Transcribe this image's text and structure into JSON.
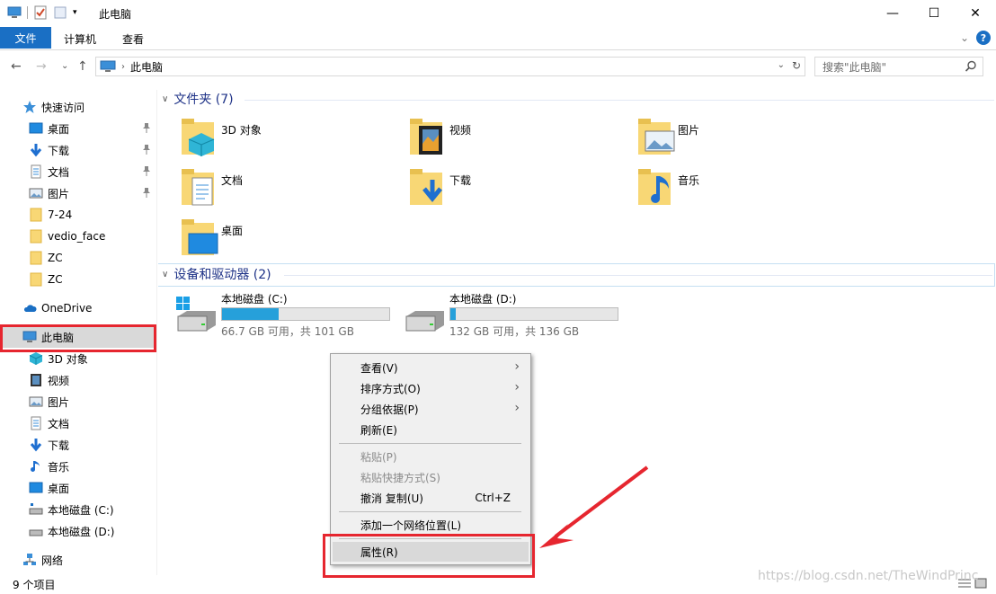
{
  "window": {
    "title": "此电脑",
    "minimize_glyph": "—",
    "maximize_glyph": "☐",
    "close_glyph": "✕"
  },
  "ribbon": {
    "tabs": [
      "文件",
      "计算机",
      "查看"
    ],
    "collapse_glyph": "⌄",
    "help_glyph": "?"
  },
  "nav": {
    "back_glyph": "←",
    "forward_glyph": "→",
    "recent_glyph": "⌄",
    "up_glyph": "↑",
    "breadcrumb": "此电脑",
    "breadcrumb_sep": "›",
    "search_placeholder": "搜索\"此电脑\""
  },
  "sidebar": {
    "items": [
      {
        "label": "快速访问",
        "icon": "star-icon"
      },
      {
        "label": "桌面",
        "icon": "desktop-icon",
        "pinned": true
      },
      {
        "label": "下载",
        "icon": "download-icon",
        "pinned": true
      },
      {
        "label": "文档",
        "icon": "document-icon",
        "pinned": true
      },
      {
        "label": "图片",
        "icon": "picture-icon",
        "pinned": true
      },
      {
        "label": "7-24",
        "icon": "folder-icon"
      },
      {
        "label": "vedio_face",
        "icon": "folder-icon"
      },
      {
        "label": "ZC",
        "icon": "folder-icon"
      },
      {
        "label": "ZC",
        "icon": "folder-icon"
      },
      {
        "label": "OneDrive",
        "icon": "cloud-icon"
      },
      {
        "label": "此电脑",
        "icon": "computer-icon",
        "selected": true
      },
      {
        "label": "3D 对象",
        "icon": "3d-objects-icon"
      },
      {
        "label": "视频",
        "icon": "video-icon"
      },
      {
        "label": "图片",
        "icon": "picture-icon"
      },
      {
        "label": "文档",
        "icon": "document-icon"
      },
      {
        "label": "下载",
        "icon": "download-icon"
      },
      {
        "label": "音乐",
        "icon": "music-icon"
      },
      {
        "label": "桌面",
        "icon": "desktop-icon"
      },
      {
        "label": "本地磁盘 (C:)",
        "icon": "drive-icon"
      },
      {
        "label": "本地磁盘 (D:)",
        "icon": "drive-icon"
      },
      {
        "label": "网络",
        "icon": "network-icon"
      }
    ]
  },
  "main": {
    "folders_header": "文件夹 (7)",
    "folders": [
      {
        "label": "3D 对象",
        "icon": "3d-objects-icon"
      },
      {
        "label": "视频",
        "icon": "video-icon"
      },
      {
        "label": "图片",
        "icon": "picture-icon"
      },
      {
        "label": "文档",
        "icon": "document-icon"
      },
      {
        "label": "下载",
        "icon": "download-icon"
      },
      {
        "label": "音乐",
        "icon": "music-icon"
      },
      {
        "label": "桌面",
        "icon": "desktop-icon"
      }
    ],
    "devices_header": "设备和驱动器 (2)",
    "drives": [
      {
        "name": "本地磁盘 (C:)",
        "info": "66.7 GB 可用，共 101 GB",
        "used_fraction": 0.34
      },
      {
        "name": "本地磁盘 (D:)",
        "info": "132 GB 可用，共 136 GB",
        "used_fraction": 0.03
      }
    ]
  },
  "context_menu": {
    "items": [
      {
        "label": "查看(V)",
        "submenu": true
      },
      {
        "label": "排序方式(O)",
        "submenu": true
      },
      {
        "label": "分组依据(P)",
        "submenu": true
      },
      {
        "label": "刷新(E)"
      },
      {
        "label": "粘贴(P)",
        "disabled": true
      },
      {
        "label": "粘贴快捷方式(S)",
        "disabled": true
      },
      {
        "label": "撤消 复制(U)",
        "shortcut": "Ctrl+Z"
      },
      {
        "label": "添加一个网络位置(L)"
      },
      {
        "label": "属性(R)",
        "highlighted": true
      }
    ]
  },
  "status": {
    "item_count": "9 个项目"
  },
  "watermark": "https://blog.csdn.net/TheWindPrinc",
  "colors": {
    "accent": "#1a6fc4",
    "drive_fill": "#26a0da",
    "annotation_red": "#e6262f",
    "section_header": "#1e3287"
  }
}
